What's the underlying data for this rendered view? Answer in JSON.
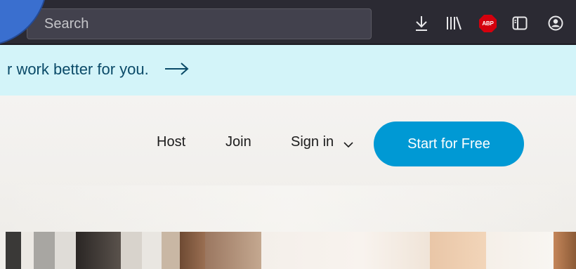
{
  "browser": {
    "search_placeholder": "Search",
    "icons": [
      "download-icon",
      "library-icon",
      "adblock-plus-icon",
      "reader-view-icon",
      "account-icon"
    ],
    "abp_label": "ABP",
    "abp_color": "#d4000d"
  },
  "banner": {
    "text": "r work better for you.",
    "arrow": "→",
    "background": "#d3f4f9"
  },
  "nav": {
    "host": "Host",
    "join": "Join",
    "sign_in": "Sign in",
    "cta": "Start for Free",
    "cta_color": "#0099d4"
  },
  "colors": {
    "toolbar": "#2b2a33",
    "corner_circle": "#3a6fcf"
  }
}
